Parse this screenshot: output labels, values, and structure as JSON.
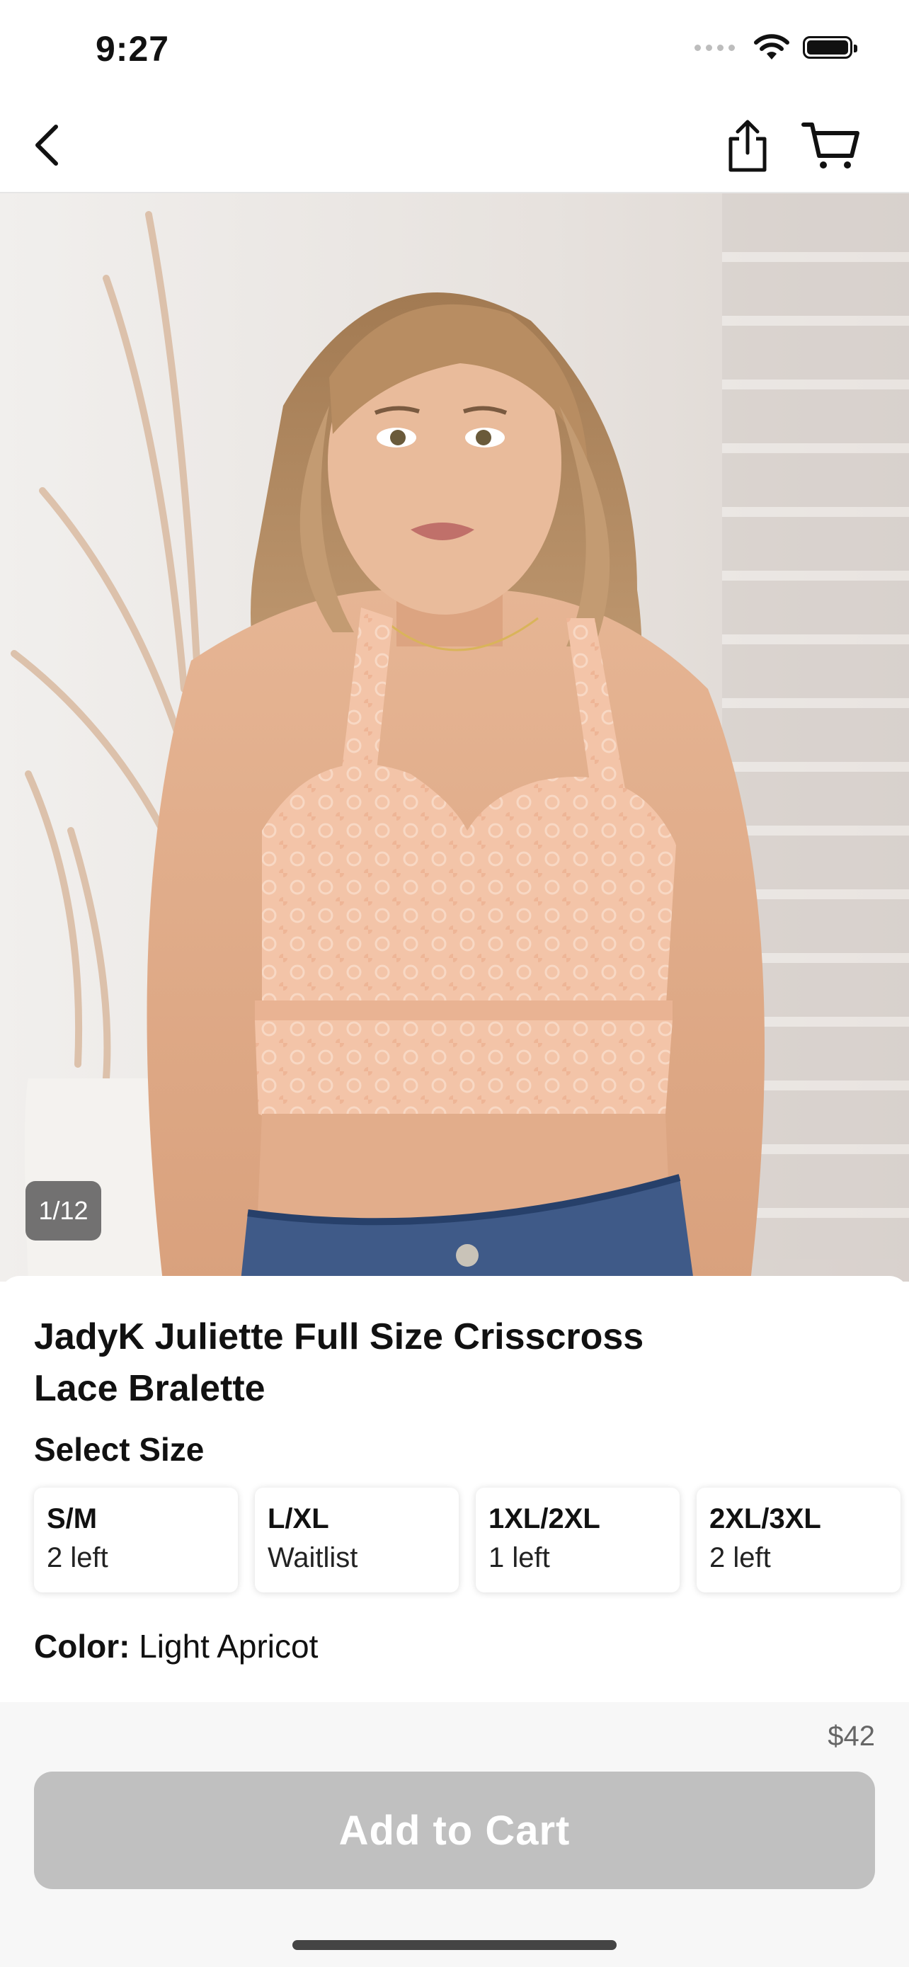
{
  "status_bar": {
    "time": "9:27"
  },
  "nav": {
    "back_icon": "chevron-left-icon",
    "share_icon": "share-icon",
    "cart_icon": "cart-icon"
  },
  "gallery": {
    "counter": "1/12"
  },
  "product": {
    "title": "JadyK Juliette Full Size Crisscross Lace Bralette",
    "select_size_label": "Select Size",
    "sizes": [
      {
        "name": "S/M",
        "availability": "2 left"
      },
      {
        "name": "L/XL",
        "availability": "Waitlist"
      },
      {
        "name": "1XL/2XL",
        "availability": "1 left"
      },
      {
        "name": "2XL/3XL",
        "availability": "2 left"
      }
    ],
    "color_label": "Color:",
    "color_value": "Light Apricot"
  },
  "purchase": {
    "price": "$42",
    "add_to_cart_label": "Add to Cart"
  },
  "colors": {
    "button_disabled": "#c0c0c0",
    "lace": "#f3c4a8"
  }
}
